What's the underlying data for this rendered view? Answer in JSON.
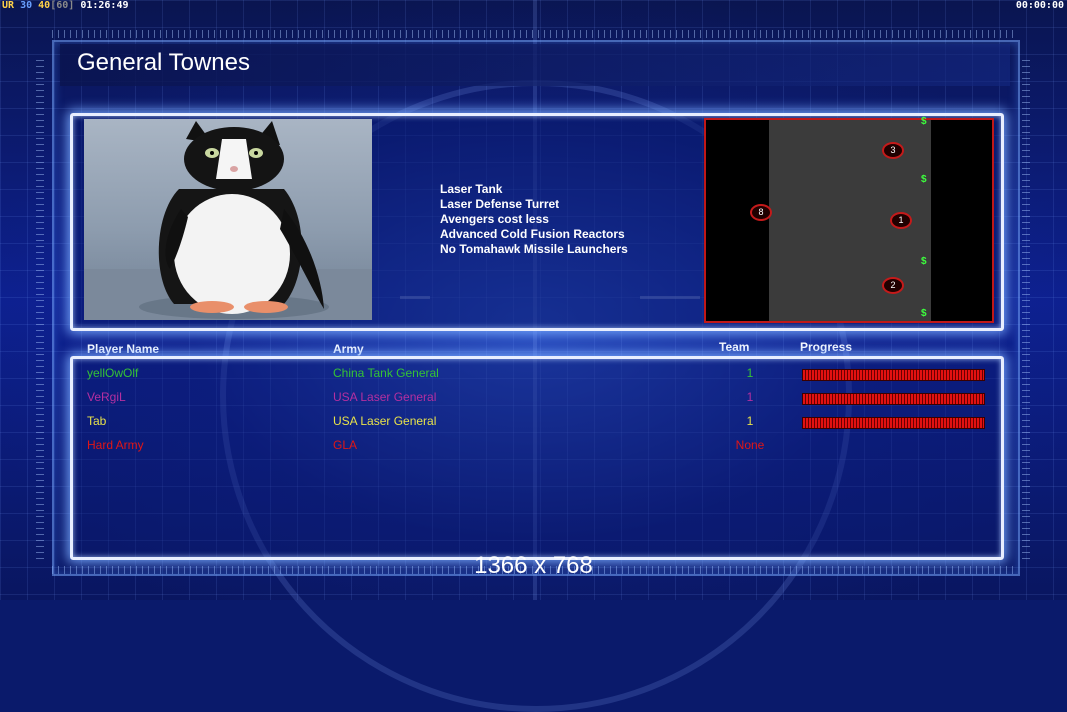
{
  "hud": {
    "fps_ur": "UR",
    "fps_value": "30",
    "fps_logic": "40",
    "fps_cap": "[60]",
    "game_time": "01:26:49",
    "timer_right": "00:00:00"
  },
  "general": {
    "title": "General Townes",
    "features": [
      "Laser Tank",
      "Laser Defense Turret",
      "Avengers cost less",
      "Advanced Cold Fusion Reactors",
      "No Tomahawk Missile Launchers"
    ]
  },
  "map": {
    "start_positions": [
      {
        "label": "3"
      },
      {
        "label": "8"
      },
      {
        "label": "1"
      },
      {
        "label": "2"
      }
    ],
    "supply_symbol": "$"
  },
  "players_table": {
    "headers": {
      "name": "Player Name",
      "army": "Army",
      "team": "Team",
      "progress": "Progress"
    },
    "rows": [
      {
        "name": "yellOwOlf",
        "army": "China Tank General",
        "team": "1",
        "color": "#35c335",
        "progress": 1.0,
        "show_progress": true
      },
      {
        "name": "VeRgiL",
        "army": "USA Laser General",
        "team": "1",
        "color": "#b52fa0",
        "progress": 1.0,
        "show_progress": true
      },
      {
        "name": "Tab",
        "army": "USA Laser General",
        "team": "1",
        "color": "#e8e24a",
        "progress": 1.0,
        "show_progress": true
      },
      {
        "name": "Hard Army",
        "army": "GLA",
        "team": "None",
        "color": "#e01616",
        "progress": 0,
        "show_progress": false
      }
    ]
  },
  "resolution_label": "1366 x 768"
}
